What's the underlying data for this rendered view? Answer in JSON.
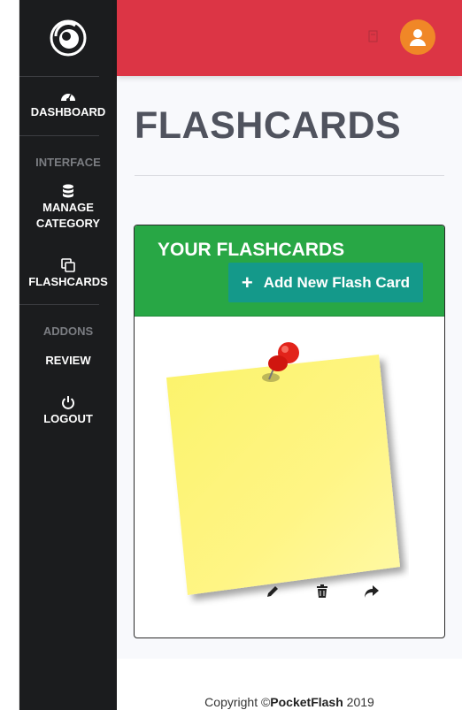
{
  "sidebar": {
    "brand_icon": "brand-swirl-logo",
    "items": [
      {
        "label": "DASHBOARD",
        "icon": "tachometer-icon"
      },
      {
        "label": "MANAGE CATEGORY",
        "icon": "database-icon"
      },
      {
        "label": "FLASHCARDS",
        "icon": "copy-icon"
      },
      {
        "label": "REVIEW",
        "icon": ""
      },
      {
        "label": "LOGOUT",
        "icon": "power-icon"
      }
    ],
    "headings": [
      "INTERFACE",
      "ADDONS"
    ]
  },
  "topbar": {
    "accent": "#dc3545",
    "avatar_color": "#f08727",
    "avatar_icon": "user-icon"
  },
  "main": {
    "title": "FLASHCARDS",
    "card": {
      "title": "YOUR FLASHCARDS",
      "add_button": "Add New Flash Card",
      "header_color": "#28a745",
      "button_color": "#14998a",
      "note_icon": "sticky-note-with-pushpin",
      "actions": [
        {
          "icon": "pencil-icon"
        },
        {
          "icon": "trash-icon"
        },
        {
          "icon": "share-arrow-icon"
        }
      ]
    }
  },
  "footer": {
    "prefix": "Copyright ©",
    "brand": "PocketFlash",
    "year": " 2019"
  }
}
